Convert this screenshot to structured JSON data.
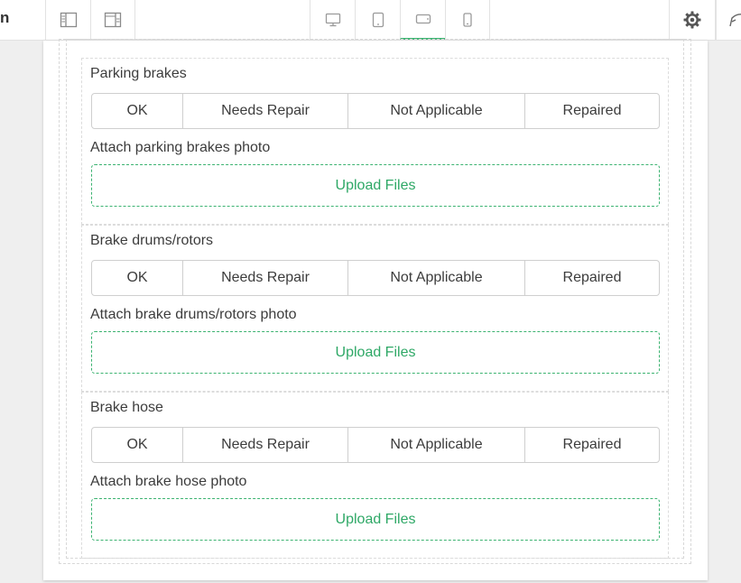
{
  "app": {
    "title_fragment": "n"
  },
  "toolbar": {
    "icons": {
      "left_panel": "left-panel-layout-icon",
      "right_panel": "right-panel-layout-icon",
      "desktop": "desktop-monitor-icon",
      "tablet": "tablet-icon",
      "tablet_landscape": "tablet-landscape-icon",
      "mobile": "mobile-phone-icon",
      "settings": "gear-icon",
      "publish": "send-icon"
    },
    "active_device": "tablet_landscape",
    "accent_color": "#3cb371"
  },
  "form": {
    "options": [
      "OK",
      "Needs Repair",
      "Not Applicable",
      "Repaired"
    ],
    "upload_label": "Upload Files",
    "fields": [
      {
        "label": "Parking brakes",
        "photo_label": "Attach parking brakes photo"
      },
      {
        "label": "Brake drums/rotors",
        "photo_label": "Attach brake drums/rotors photo"
      },
      {
        "label": "Brake hose",
        "photo_label": "Attach brake hose photo"
      }
    ]
  }
}
